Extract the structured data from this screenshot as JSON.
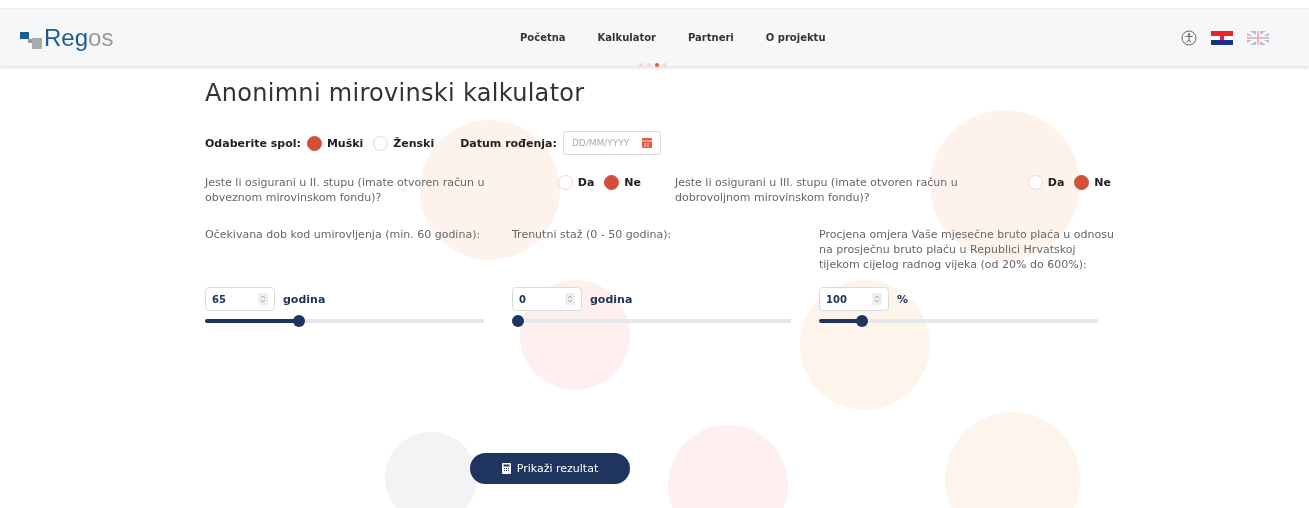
{
  "logo": {
    "primary": "Reg",
    "secondary": "os"
  },
  "nav": [
    {
      "label": "Početna"
    },
    {
      "label": "Kalkulator"
    },
    {
      "label": "Partneri"
    },
    {
      "label": "O projektu"
    }
  ],
  "languages": [
    {
      "kind": "croatian",
      "selected": true
    },
    {
      "kind": "british",
      "selected": false
    }
  ],
  "carousel_dots": [
    {
      "selected": false
    },
    {
      "selected": false
    },
    {
      "selected": true
    },
    {
      "selected": false
    }
  ],
  "title": "Anonimni mirovinski kalkulator",
  "gender": {
    "label": "Odaberite spol:",
    "options": [
      {
        "label": "Muški",
        "selected": true
      },
      {
        "label": "Ženski",
        "selected": false
      }
    ]
  },
  "birth_date": {
    "label": "Datum rođenja:",
    "placeholder": "DD/MM/YYYY"
  },
  "pillars": [
    {
      "question": "Jeste li osigurani u II. stupu (imate otvoren račun u obveznom mirovinskom fondu)?",
      "options": [
        {
          "label": "Da",
          "selected": false
        },
        {
          "label": "Ne",
          "selected": true
        }
      ]
    },
    {
      "question": "Jeste li osigurani u III. stupu (imate otvoren račun u dobrovoljnom mirovinskom fondu)?",
      "options": [
        {
          "label": "Da",
          "selected": false
        },
        {
          "label": "Ne",
          "selected": true
        }
      ]
    }
  ],
  "sliders": [
    {
      "label": "Očekivana dob kod umirovljenja (min. 60 godina):",
      "value": "65",
      "unit": "godina",
      "level": 0.33
    },
    {
      "label": "Trenutni staž (0 - 50 godina):",
      "value": "0",
      "unit": "godina",
      "level": 0
    },
    {
      "label": "Procjena omjera Vaše mjesečne bruto plaća u odnosu na prosječnu bruto plaću u Republici Hrvatskoj tijekom cijelog radnog vijeka (od 20% do 600%):",
      "value": "100",
      "unit": "%",
      "level": 0.14
    }
  ],
  "submit": "Prikaži rezultat"
}
